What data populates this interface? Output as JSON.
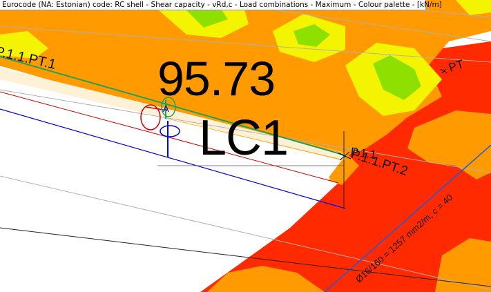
{
  "header": {
    "caption": "Eurocode (NA: Estonian) code: RC shell - Shear capacity - vRd,c - Load combinations - Maximum - Colour palette - [kN/m]"
  },
  "result": {
    "value": "95.73",
    "load_case": "LC1"
  },
  "labels": {
    "edge_upper": "P.1.1.PT.1",
    "edge_lower": "P.1.1.PT.2",
    "point_label": "PT",
    "node_label": "P.1.1",
    "axis_label": "A",
    "rebar_note": "Ø16/160 = 1257 mm2/m, c = 40"
  },
  "palette": {
    "red": "#ff2a00",
    "orange": "#ff9a00",
    "yellow": "#f4f400",
    "green": "#8ee000",
    "edge_green": "#1aa35a",
    "edge_red": "#d00000",
    "edge_blue": "#0000dd",
    "rebar_blue": "#1a5adf"
  }
}
